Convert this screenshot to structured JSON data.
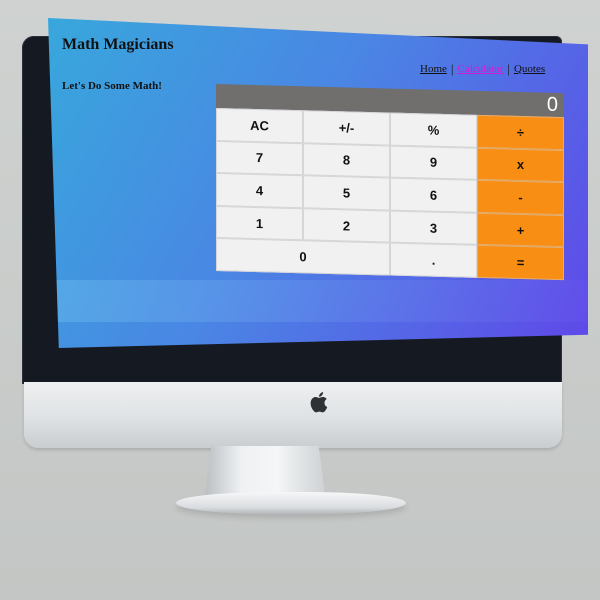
{
  "app": {
    "title": "Math Magicians",
    "subtitle": "Let's Do Some Math!"
  },
  "nav": {
    "items": [
      {
        "label": "Home",
        "active": false
      },
      {
        "label": "Calculator",
        "active": true
      },
      {
        "label": "Quotes",
        "active": false
      }
    ],
    "separator": "|"
  },
  "calculator": {
    "display_value": "0",
    "keys": {
      "ac": "AC",
      "sign": "+/-",
      "percent": "%",
      "divide": "÷",
      "seven": "7",
      "eight": "8",
      "nine": "9",
      "multiply": "x",
      "four": "4",
      "five": "5",
      "six": "6",
      "subtract": "-",
      "one": "1",
      "two": "2",
      "three": "3",
      "add": "+",
      "zero": "0",
      "decimal": ".",
      "equals": "="
    }
  },
  "colors": {
    "operator_key": "#f98e14",
    "display_bg": "#716e6e",
    "active_nav": "#d41ad4",
    "gradient_start": "#38a7dc",
    "gradient_end": "#5f48e8"
  },
  "icons": {
    "device_logo": "apple-logo-icon"
  }
}
